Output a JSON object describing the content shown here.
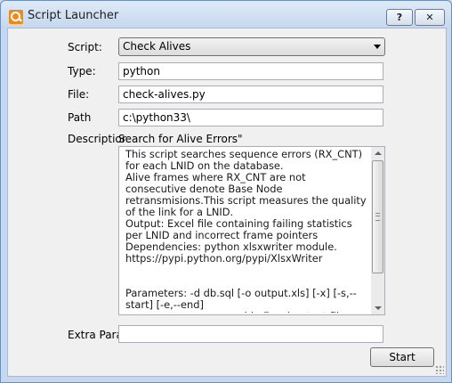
{
  "window": {
    "title": "Script Launcher",
    "help_label": "?",
    "close_label": "✕"
  },
  "form": {
    "script_label": "Script:",
    "script_value": "Check Alives",
    "type_label": "Type:",
    "type_value": "python",
    "file_label": "File:",
    "file_value": "check-alives.py",
    "path_label": "Path",
    "path_value": "c:\\python33\\",
    "description_label": "Descriptior",
    "description_summary": "Search for Alive Errors\"",
    "description_body": "This script searches sequence errors (RX_CNT) for each LNID on the database.\nAlive frames where RX_CNT are not consecutive denote Base Node retransmisions.This script measures the quality of the link for a LNID.\nOutput: Excel file containing failing statistics per LNID and incorrect frame pointers\nDependencies: python xlsxwriter module. https://pypi.python.org/pypi/XlsxWriter\n\n\nParameters: -d db.sql [-o output.xls] [-x] [-s,--start] [-e,--end]\n                          -x: enable Excel output file generation.\n   Default: false",
    "extra_params_label": "Extra Para",
    "extra_params_value": ""
  },
  "actions": {
    "start_label": "Start"
  },
  "icons": {
    "app": "script-launcher-icon",
    "combo": "chevron-down-icon"
  }
}
